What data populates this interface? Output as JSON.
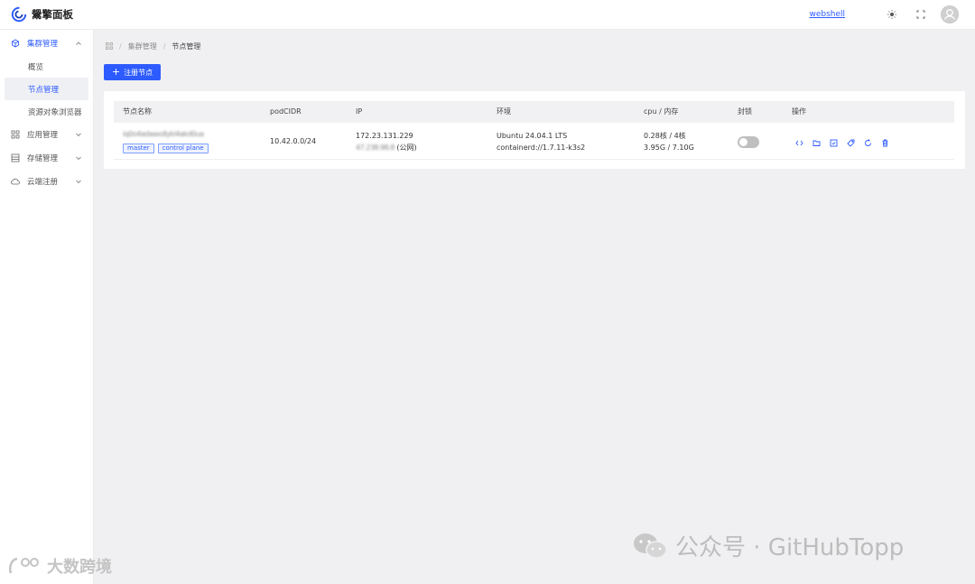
{
  "app": {
    "title": "鬶擎面板"
  },
  "header": {
    "webshell_label": "webshell"
  },
  "sidebar": {
    "groups": [
      {
        "label": "集群管理",
        "children": [
          "概览",
          "节点管理",
          "资源对象浏览器"
        ]
      },
      {
        "label": "应用管理"
      },
      {
        "label": "存储管理"
      },
      {
        "label": "云端注册"
      }
    ],
    "selected": "节点管理"
  },
  "breadcrumb": {
    "items": [
      "集群管理",
      "节点管理"
    ]
  },
  "toolbar": {
    "register_label": "注册节点"
  },
  "table": {
    "columns": [
      "节点名称",
      "podCIDR",
      "IP",
      "环境",
      "cpu / 内存",
      "封锁",
      "操作"
    ],
    "rows": [
      {
        "name": "iq0o4adaaxdlyki4akd0ua",
        "tags": [
          "master",
          "control plane"
        ],
        "podcidr": "10.42.0.0/24",
        "ip_internal": "172.23.131.229",
        "ip_public": "47.238.98.8",
        "ip_public_suffix": "(公网)",
        "env_os": "Ubuntu 24.04.1 LTS",
        "env_runtime": "containerd://1.7.11-k3s2",
        "cpu": "0.28核 / 4核",
        "memory": "3.95G / 7.10G",
        "cordoned": false
      }
    ]
  },
  "watermarks": {
    "right": "公众号 · GitHubTopp",
    "left": "大数跨境"
  },
  "colors": {
    "accent": "#2d5bff",
    "sidebar_selected_bg": "#eff0f4",
    "page_bg": "#f0f0f2"
  }
}
